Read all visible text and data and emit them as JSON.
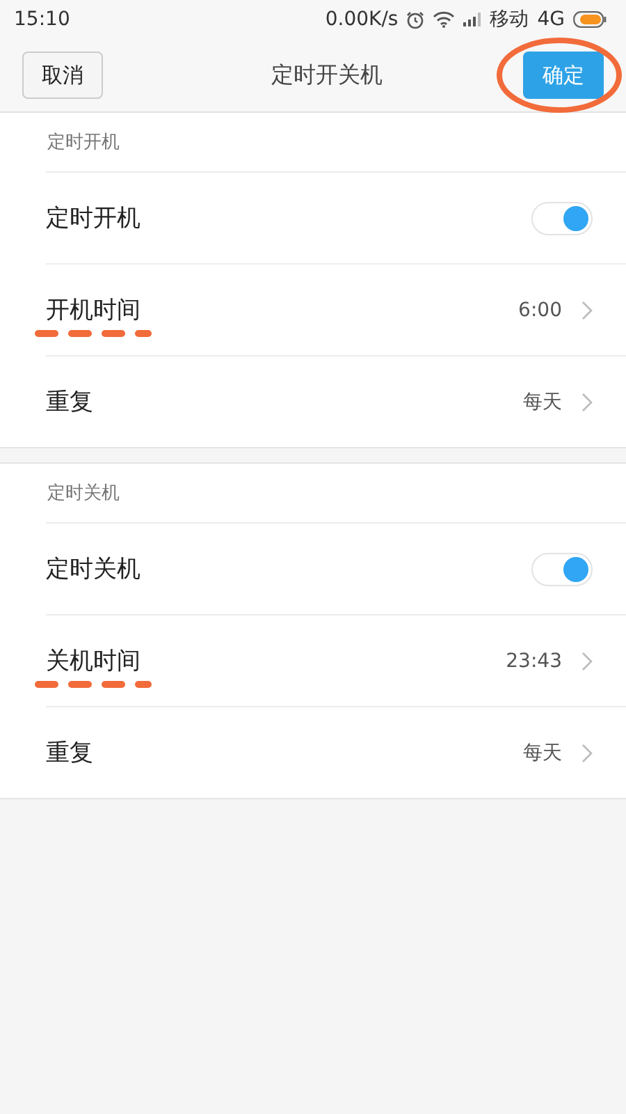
{
  "status_bar": {
    "time": "15:10",
    "speed": "0.00K/s",
    "carrier": "移动",
    "network": "4G"
  },
  "header": {
    "cancel": "取消",
    "title": "定时开关机",
    "confirm": "确定",
    "confirm_circled": true
  },
  "sections": [
    {
      "title": "定时开机",
      "rows": [
        {
          "kind": "toggle",
          "label": "定时开机",
          "on": true
        },
        {
          "kind": "link",
          "label": "开机时间",
          "value": "6:00",
          "underlined": true
        },
        {
          "kind": "link",
          "label": "重复",
          "value": "每天",
          "underlined": false
        }
      ]
    },
    {
      "title": "定时关机",
      "rows": [
        {
          "kind": "toggle",
          "label": "定时关机",
          "on": true
        },
        {
          "kind": "link",
          "label": "关机时间",
          "value": "23:43",
          "underlined": true
        },
        {
          "kind": "link",
          "label": "重复",
          "value": "每天",
          "underlined": false
        }
      ]
    }
  ]
}
